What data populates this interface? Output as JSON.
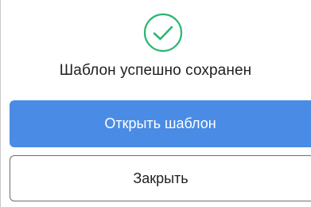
{
  "dialog": {
    "icon": "check-circle-icon",
    "message": "Шаблон успешно сохранен",
    "primary_button": "Открыть шаблон",
    "secondary_button": "Закрыть"
  },
  "colors": {
    "success": "#2bb673",
    "primary": "#4a8be5",
    "text": "#1f1f1f",
    "border": "#6e6e6e"
  }
}
